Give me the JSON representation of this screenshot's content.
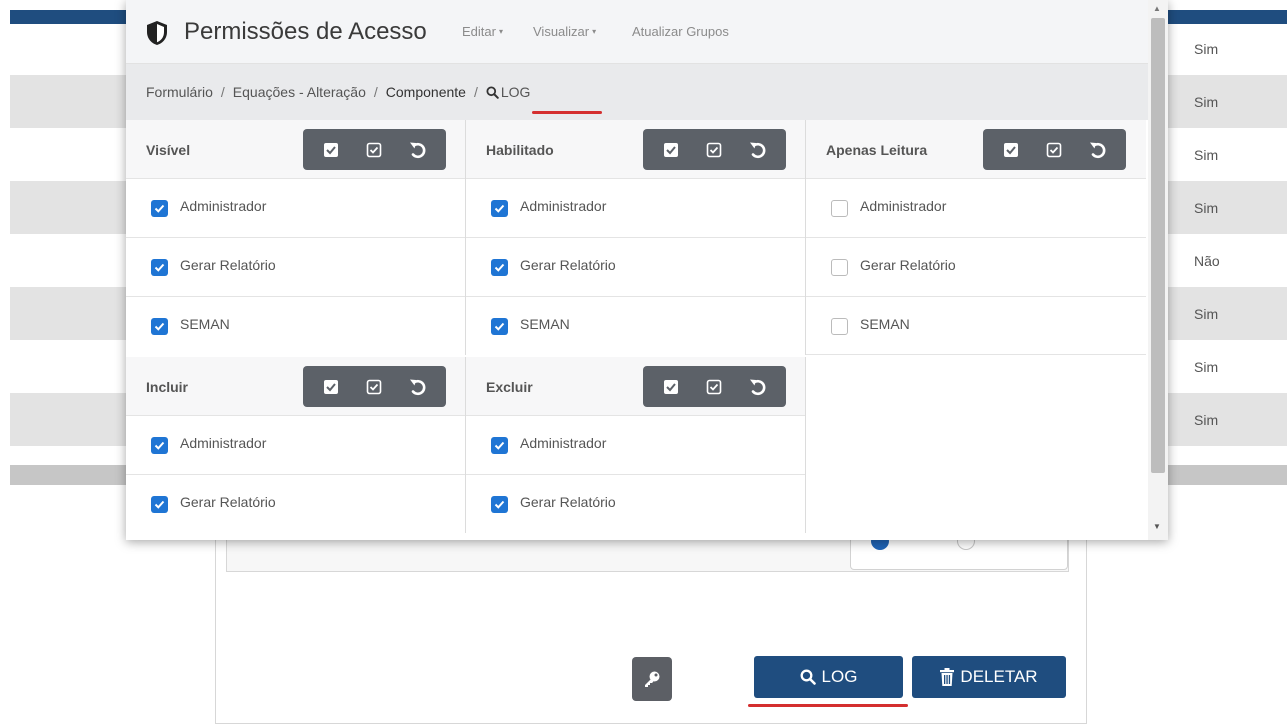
{
  "background": {
    "rows": [
      {
        "value": "Sim",
        "shaded": false
      },
      {
        "value": "Sim",
        "shaded": true
      },
      {
        "value": "Sim",
        "shaded": false
      },
      {
        "value": "Sim",
        "shaded": true
      },
      {
        "value": "Não",
        "shaded": false
      },
      {
        "value": "Sim",
        "shaded": true
      },
      {
        "value": "Sim",
        "shaded": false
      },
      {
        "value": "Sim",
        "shaded": true
      }
    ],
    "log_button": "LOG",
    "delete_button": "DELETAR"
  },
  "modal": {
    "title": "Permissões de Acesso",
    "menu": {
      "edit": "Editar",
      "view": "Visualizar",
      "refresh": "Atualizar Grupos"
    },
    "breadcrumb": {
      "form": "Formulário",
      "equations": "Equações - Alteração",
      "component": "Componente",
      "log": "LOG"
    },
    "columns": [
      {
        "title": "Visível",
        "items": [
          {
            "label": "Administrador",
            "checked": true
          },
          {
            "label": "Gerar Relatório",
            "checked": true
          },
          {
            "label": "SEMAN",
            "checked": true
          }
        ]
      },
      {
        "title": "Habilitado",
        "items": [
          {
            "label": "Administrador",
            "checked": true
          },
          {
            "label": "Gerar Relatório",
            "checked": true
          },
          {
            "label": "SEMAN",
            "checked": true
          }
        ]
      },
      {
        "title": "Apenas Leitura",
        "items": [
          {
            "label": "Administrador",
            "checked": false
          },
          {
            "label": "Gerar Relatório",
            "checked": false
          },
          {
            "label": "SEMAN",
            "checked": false
          }
        ]
      },
      {
        "title": "Incluir",
        "items": [
          {
            "label": "Administrador",
            "checked": true
          },
          {
            "label": "Gerar Relatório",
            "checked": true
          }
        ]
      },
      {
        "title": "Excluir",
        "items": [
          {
            "label": "Administrador",
            "checked": true
          },
          {
            "label": "Gerar Relatório",
            "checked": true
          }
        ]
      }
    ],
    "column_buttons": [
      "check-all-icon",
      "check-square-icon",
      "undo-icon"
    ]
  },
  "colors": {
    "primary": "#1f4d7f",
    "checkbox": "#1f75d4",
    "highlight": "#d42f2f",
    "button_group": "#5c6168"
  }
}
